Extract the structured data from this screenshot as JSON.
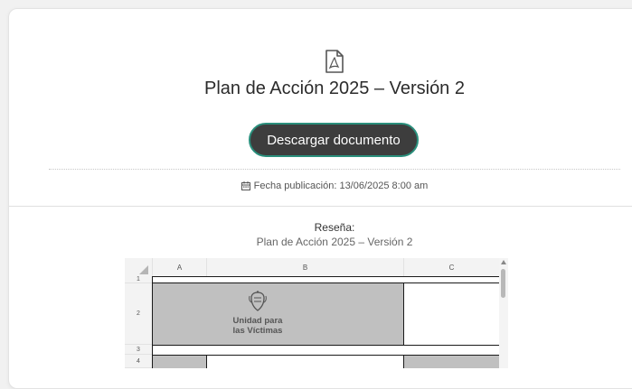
{
  "document": {
    "icon": "pdf-file-icon",
    "title": "Plan de Acción 2025 – Versión 2",
    "download_label": "Descargar documento",
    "publication_date": "Fecha publicación: 13/06/2025 8:00 am",
    "date_icon": "calendar-icon"
  },
  "resena": {
    "label": "Reseña:",
    "text": "Plan de Acción 2025 – Versión 2"
  },
  "spreadsheet": {
    "columns": [
      "A",
      "B",
      "C"
    ],
    "rows": [
      "1",
      "2",
      "3",
      "4"
    ],
    "logo_line1": "Unidad para",
    "logo_line2": "las Víctimas",
    "colors": {
      "cell_fill": "#c0c0c0",
      "header_bg": "#f3f3f3"
    }
  },
  "colors": {
    "button_bg": "#3d3d3d",
    "button_border": "#2a8f7c",
    "page_bg": "#f1f1f1"
  }
}
